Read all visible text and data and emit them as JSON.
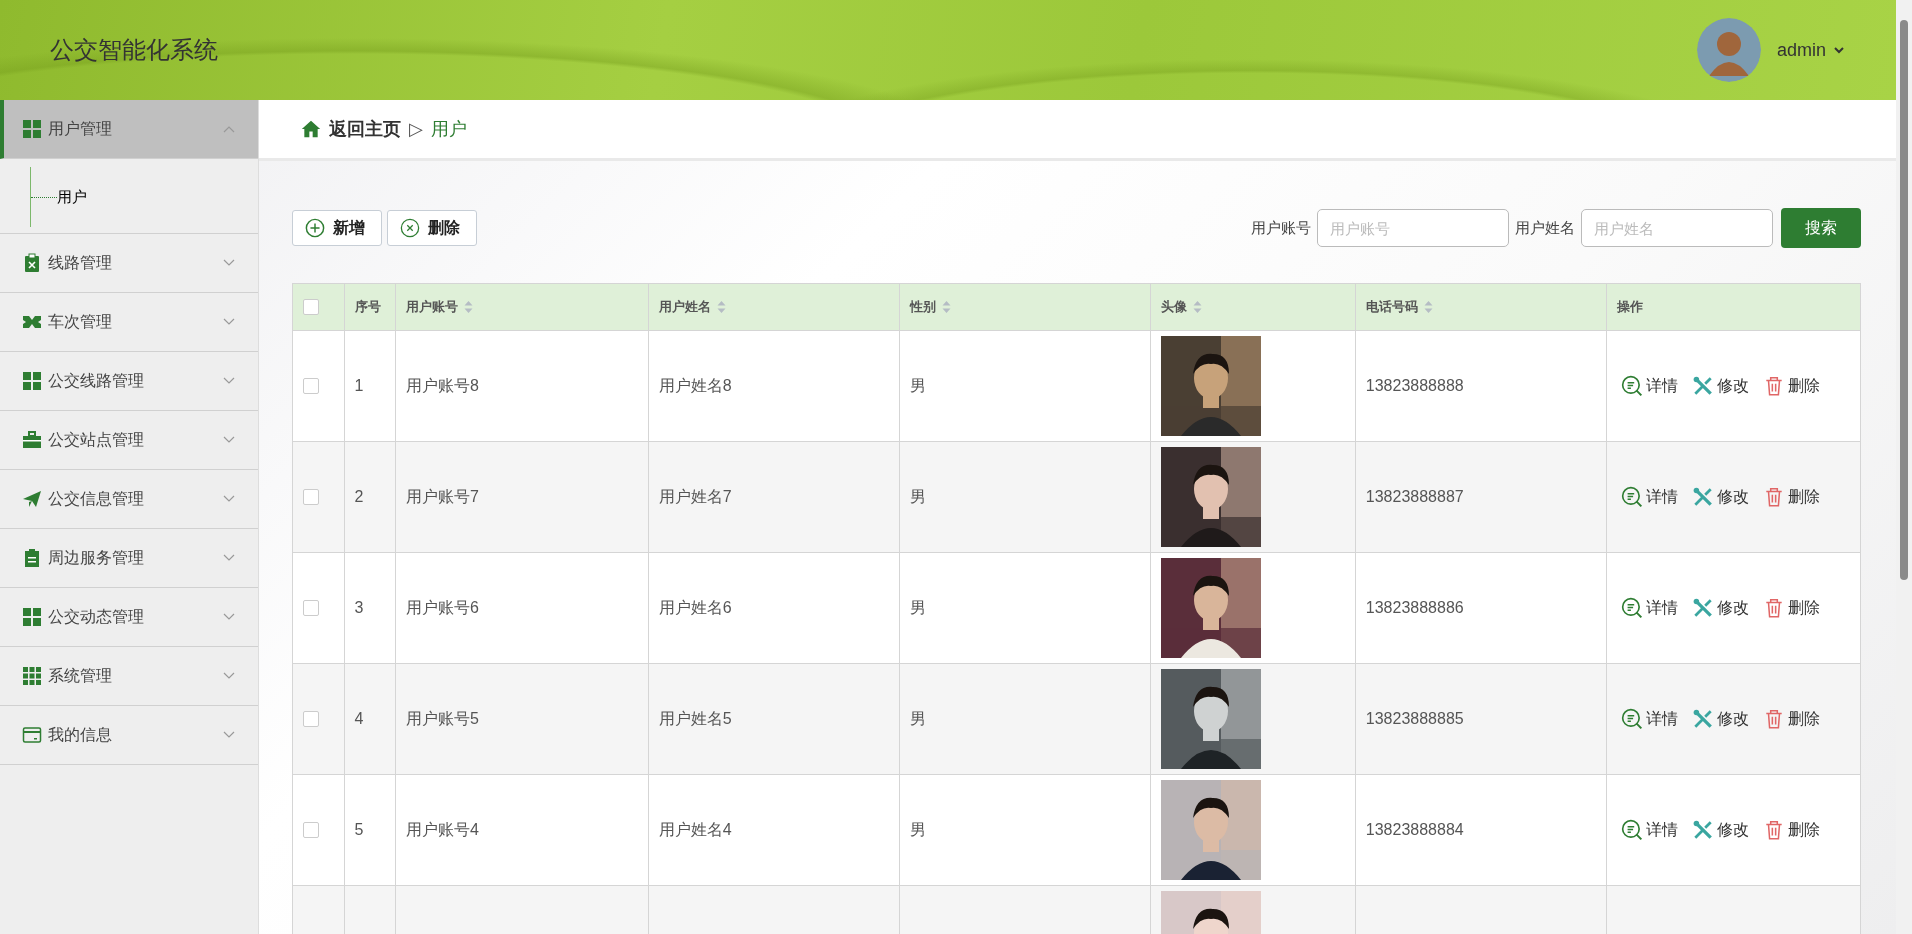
{
  "header": {
    "title": "公交智能化系统",
    "user": "admin"
  },
  "sidebar": {
    "items": [
      {
        "label": "用户管理",
        "expanded": true,
        "selected": true,
        "children": [
          {
            "label": "用户",
            "selected": true
          }
        ]
      },
      {
        "label": "线路管理",
        "expanded": false,
        "selected": false
      },
      {
        "label": "车次管理",
        "expanded": false,
        "selected": false
      },
      {
        "label": "公交线路管理",
        "expanded": false,
        "selected": false
      },
      {
        "label": "公交站点管理",
        "expanded": false,
        "selected": false
      },
      {
        "label": "公交信息管理",
        "expanded": false,
        "selected": false
      },
      {
        "label": "周边服务管理",
        "expanded": false,
        "selected": false
      },
      {
        "label": "公交动态管理",
        "expanded": false,
        "selected": false
      },
      {
        "label": "系统管理",
        "expanded": false,
        "selected": false
      },
      {
        "label": "我的信息",
        "expanded": false,
        "selected": false
      }
    ]
  },
  "breadcrumb": {
    "home": "返回主页",
    "separator": "▷",
    "current": "用户"
  },
  "toolbar": {
    "buttons": [
      {
        "label": "新增",
        "kind": "add"
      },
      {
        "label": "删除",
        "kind": "delete"
      }
    ],
    "filters": [
      {
        "label": "用户账号",
        "placeholder": "用户账号"
      },
      {
        "label": "用户姓名",
        "placeholder": "用户姓名"
      }
    ],
    "search_button": "搜索"
  },
  "table": {
    "select_all_checked": false,
    "columns": [
      {
        "label": "序号",
        "sortable": false
      },
      {
        "label": "用户账号",
        "sortable": true
      },
      {
        "label": "用户姓名",
        "sortable": true
      },
      {
        "label": "性别",
        "sortable": true
      },
      {
        "label": "头像",
        "sortable": true
      },
      {
        "label": "电话号码",
        "sortable": true
      },
      {
        "label": "操作",
        "sortable": false
      }
    ],
    "rows": [
      {
        "checked": false,
        "index": "1",
        "account": "用户账号8",
        "name": "用户姓名8",
        "gender": "男",
        "avatar": {
          "kind": "picture"
        },
        "phone": "13823888888",
        "actions": [
          {
            "label": "详情",
            "kind": "detail"
          },
          {
            "label": "修改",
            "kind": "edit"
          },
          {
            "label": "删除",
            "kind": "delete"
          }
        ]
      },
      {
        "checked": false,
        "index": "2",
        "account": "用户账号7",
        "name": "用户姓名7",
        "gender": "男",
        "avatar": {
          "kind": "picture"
        },
        "phone": "13823888887",
        "actions": [
          {
            "label": "详情",
            "kind": "detail"
          },
          {
            "label": "修改",
            "kind": "edit"
          },
          {
            "label": "删除",
            "kind": "delete"
          }
        ]
      },
      {
        "checked": false,
        "index": "3",
        "account": "用户账号6",
        "name": "用户姓名6",
        "gender": "男",
        "avatar": {
          "kind": "picture"
        },
        "phone": "13823888886",
        "actions": [
          {
            "label": "详情",
            "kind": "detail"
          },
          {
            "label": "修改",
            "kind": "edit"
          },
          {
            "label": "删除",
            "kind": "delete"
          }
        ]
      },
      {
        "checked": false,
        "index": "4",
        "account": "用户账号5",
        "name": "用户姓名5",
        "gender": "男",
        "avatar": {
          "kind": "picture"
        },
        "phone": "13823888885",
        "actions": [
          {
            "label": "详情",
            "kind": "detail"
          },
          {
            "label": "修改",
            "kind": "edit"
          },
          {
            "label": "删除",
            "kind": "delete"
          }
        ]
      },
      {
        "checked": false,
        "index": "5",
        "account": "用户账号4",
        "name": "用户姓名4",
        "gender": "男",
        "avatar": {
          "kind": "picture"
        },
        "phone": "13823888884",
        "actions": [
          {
            "label": "详情",
            "kind": "detail"
          },
          {
            "label": "修改",
            "kind": "edit"
          },
          {
            "label": "删除",
            "kind": "delete"
          }
        ]
      },
      {
        "avatar": {
          "kind": "picture"
        }
      }
    ]
  }
}
